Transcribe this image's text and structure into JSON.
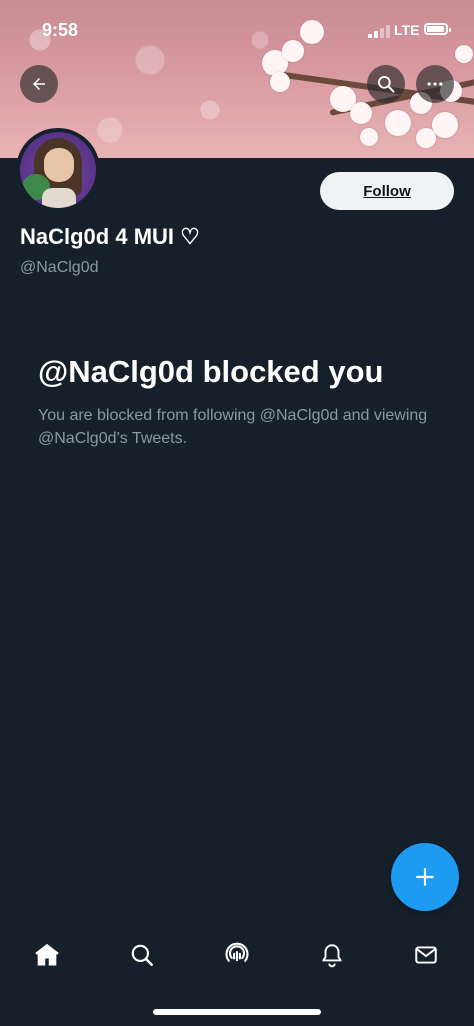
{
  "status_bar": {
    "time": "9:58",
    "network": "LTE",
    "battery_level": 0.95
  },
  "header": {
    "back_icon": "arrow-left-icon",
    "search_icon": "search-icon",
    "more_icon": "more-horizontal-icon"
  },
  "profile": {
    "display_name": "NaClg0d 4 MUI ♡",
    "handle": "@NaClg0d",
    "follow_label": "Follow"
  },
  "blocked": {
    "title": "@NaClg0d blocked you",
    "description": "You are blocked from following @NaClg0d and viewing @NaClg0d’s Tweets."
  },
  "fab": {
    "icon": "plus-icon"
  },
  "bottom_nav": [
    {
      "icon": "home-icon",
      "active": true
    },
    {
      "icon": "search-icon"
    },
    {
      "icon": "spaces-icon"
    },
    {
      "icon": "bell-icon"
    },
    {
      "icon": "mail-icon"
    }
  ],
  "colors": {
    "background": "#15202b",
    "text_secondary": "#8b98a5",
    "accent": "#1d9bf0",
    "follow_button": "#eff3f4"
  }
}
